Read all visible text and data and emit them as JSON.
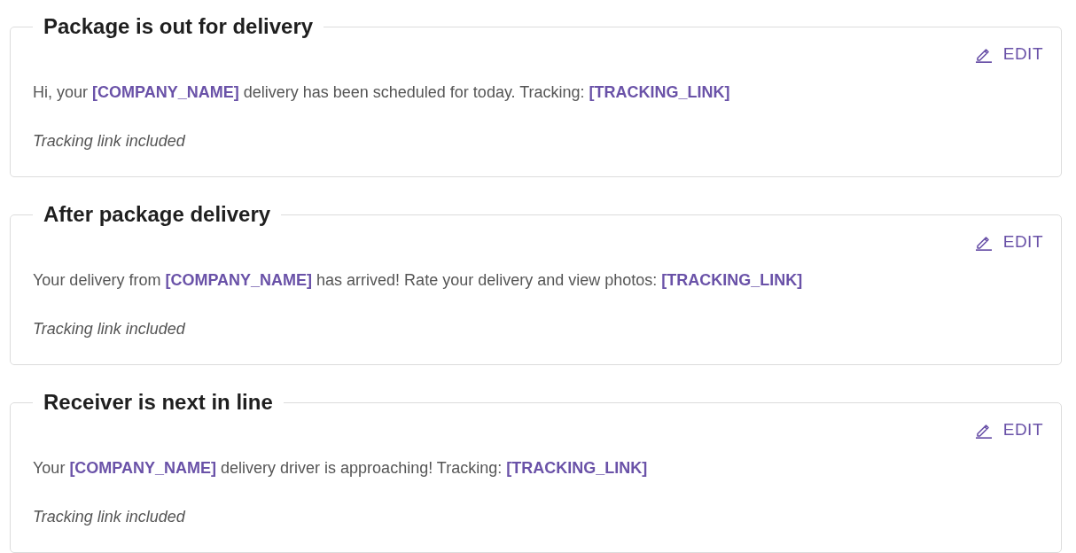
{
  "cards": [
    {
      "title": "Package is out for delivery",
      "action": "EDIT",
      "message": "Hi, your **[COMPANY_NAME]** delivery has been scheduled for today. Tracking: **[TRACKING_LINK]**",
      "note": "Tracking link included"
    },
    {
      "title": "After package delivery",
      "action": "EDIT",
      "message": "Your delivery from **[COMPANY_NAME]** has arrived! Rate your delivery and view photos: **[TRACKING_LINK]**",
      "note": "Tracking link included"
    },
    {
      "title": "Receiver is next in line",
      "action": "EDIT",
      "message": "Your **[COMPANY_NAME]** delivery driver is approaching! Tracking: **[TRACKING_LINK]**",
      "note": "Tracking link included"
    }
  ]
}
